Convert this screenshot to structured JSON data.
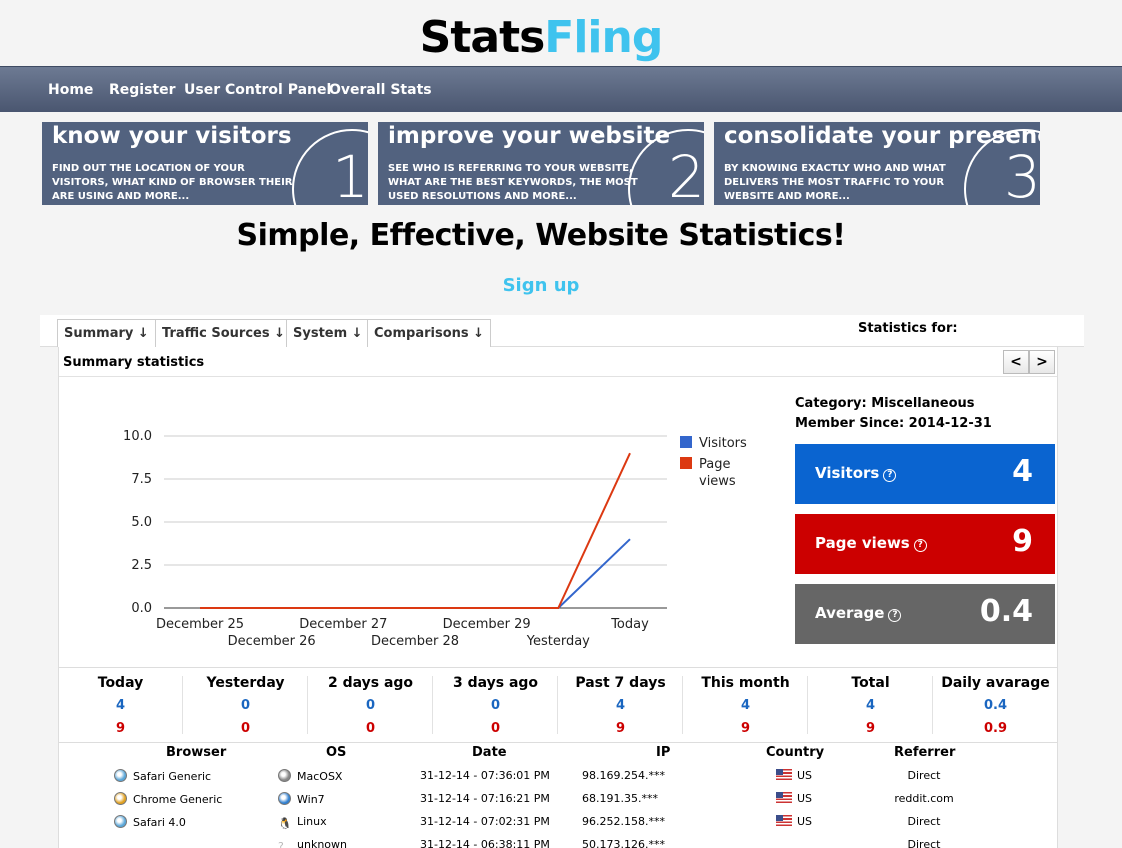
{
  "logo": {
    "part1": "Stats",
    "part2": "Fling"
  },
  "nav": {
    "items": [
      "Home",
      "Register",
      "User Control Panel",
      "Overall Stats"
    ]
  },
  "banners": [
    {
      "title": "know your visitors",
      "desc": "Find out the location of your visitors, what kind of browser their are using and more...",
      "number": "1"
    },
    {
      "title": "improve your website",
      "desc": "See who is referring to your website, what are the best keywords, the most used resolutions and more...",
      "number": "2"
    },
    {
      "title": "consolidate your presence",
      "desc": "By knowing exactly who and what delivers the most traffic to your website and more...",
      "number": "3"
    }
  ],
  "headline": "Simple, Effective, Website Statistics!",
  "signup": "Sign up",
  "tabs": [
    "Summary ↓",
    "Traffic Sources ↓",
    "System ↓",
    "Comparisons ↓"
  ],
  "statistics_for": "Statistics for:",
  "panel": {
    "title": "Summary statistics",
    "prev": "<",
    "next": ">"
  },
  "info": {
    "category": "Category: Miscellaneous",
    "member_since": "Member Since: 2014-12-31"
  },
  "stat_boxes": [
    {
      "label": "Visitors",
      "value": "4",
      "color": "#0a64d0"
    },
    {
      "label": "Page views",
      "value": "9",
      "color": "#cc0000"
    },
    {
      "label": "Average",
      "value": "0.4",
      "color": "#666666"
    }
  ],
  "chart_data": {
    "type": "line",
    "categories": [
      "December 25",
      "December 26",
      "December 27",
      "December 28",
      "December 29",
      "Yesterday",
      "Today"
    ],
    "series": [
      {
        "name": "Visitors",
        "values": [
          0,
          0,
          0,
          0,
          0,
          0,
          4
        ],
        "color": "#3366cc"
      },
      {
        "name": "Page views",
        "values": [
          0,
          0,
          0,
          0,
          0,
          0,
          9
        ],
        "color": "#dc3912"
      }
    ],
    "yticks": [
      "0.0",
      "2.5",
      "5.0",
      "7.5",
      "10.0"
    ],
    "ylim": [
      0,
      10
    ],
    "legend": "right",
    "grid": true
  },
  "periods": {
    "headers": [
      "Today",
      "Yesterday",
      "2 days ago",
      "3 days ago",
      "Past 7 days",
      "This month",
      "Total",
      "Daily avarage"
    ],
    "visitors": [
      "4",
      "0",
      "0",
      "0",
      "4",
      "4",
      "4",
      "0.4"
    ],
    "pageviews": [
      "9",
      "0",
      "0",
      "0",
      "9",
      "9",
      "9",
      "0.9"
    ]
  },
  "visits": {
    "headers": [
      "Browser",
      "OS",
      "Date",
      "IP",
      "Country",
      "Referrer"
    ],
    "rows": [
      {
        "browser": "Safari Generic",
        "browser_icon": "safari-icon",
        "os": "MacOSX",
        "os_icon": "mac-icon",
        "date": "31-12-14 - 07:36:01 PM",
        "ip": "98.169.254.***",
        "country": "US",
        "referrer": "Direct"
      },
      {
        "browser": "Chrome Generic",
        "browser_icon": "chrome-icon",
        "os": "Win7",
        "os_icon": "windows-icon",
        "date": "31-12-14 - 07:16:21 PM",
        "ip": "68.191.35.***",
        "country": "US",
        "referrer": "reddit.com"
      },
      {
        "browser": "Safari 4.0",
        "browser_icon": "safari-icon",
        "os": "Linux",
        "os_icon": "linux-icon",
        "date": "31-12-14 - 07:02:31 PM",
        "ip": "96.252.158.***",
        "country": "US",
        "referrer": "Direct"
      },
      {
        "browser": "",
        "browser_icon": "",
        "os": "unknown",
        "os_icon": "unknown-icon",
        "date": "31-12-14 - 06:38:11 PM",
        "ip": "50.173.126.***",
        "country": "",
        "referrer": "Direct"
      }
    ]
  }
}
